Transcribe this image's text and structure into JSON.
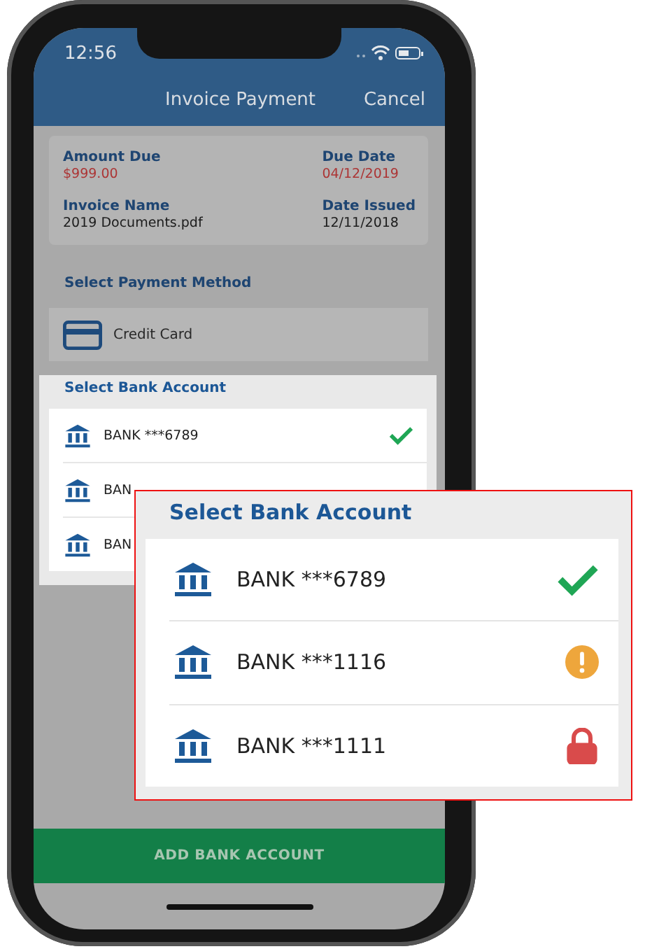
{
  "status_bar": {
    "time": "12:56"
  },
  "nav": {
    "title": "Invoice Payment",
    "action": "Cancel"
  },
  "invoice": {
    "fields": [
      {
        "label": "Amount Due",
        "value": "$999.00",
        "highlight": true
      },
      {
        "label": "Due Date",
        "value": "04/12/2019",
        "highlight": true
      },
      {
        "label": "Invoice Name",
        "value": "2019 Documents.pdf",
        "highlight": false
      },
      {
        "label": "Date Issued",
        "value": "12/11/2018",
        "highlight": false
      }
    ]
  },
  "payment_method": {
    "heading": "Select Payment Method",
    "option": "Credit Card"
  },
  "bank_sheet": {
    "title": "Select Bank Account",
    "accounts": [
      {
        "name": "BANK ***6789",
        "kind": "verified"
      },
      {
        "name": "BAN"
      },
      {
        "name": "BAN"
      }
    ]
  },
  "button": "ADD BANK ACCOUNT",
  "callout": {
    "title": "Select Bank Account",
    "accounts": [
      {
        "name": "BANK ***6789",
        "kind": "verified"
      },
      {
        "name": "BANK ***1116",
        "kind": "warning"
      },
      {
        "name": "BANK ***1111",
        "kind": "locked"
      }
    ]
  }
}
